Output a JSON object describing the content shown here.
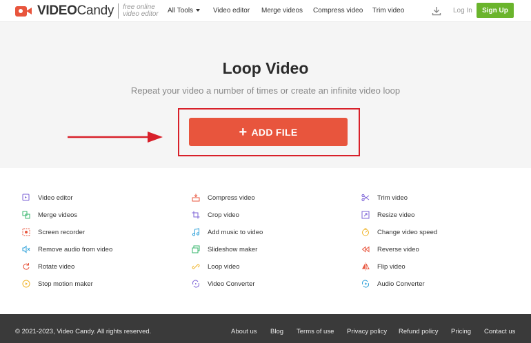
{
  "header": {
    "logo": {
      "brand_bold": "VIDEO",
      "brand_regular": "Candy",
      "tagline_line1": "free online",
      "tagline_line2": "video editor"
    },
    "nav": [
      {
        "label": "All Tools",
        "has_caret": true
      },
      {
        "label": "Video editor"
      },
      {
        "label": "Merge videos"
      },
      {
        "label": "Compress video"
      },
      {
        "label": "Trim video"
      }
    ],
    "download_icon": "download-icon",
    "login_label": "Log In",
    "signup_label": "Sign Up"
  },
  "hero": {
    "title": "Loop Video",
    "subtitle": "Repeat your video a number of times or create an infinite video loop",
    "add_file_label": "ADD FILE"
  },
  "tools": {
    "col1": [
      {
        "label": "Video editor",
        "icon": "video-editor-icon",
        "color": "#7b61d6"
      },
      {
        "label": "Merge videos",
        "icon": "merge-icon",
        "color": "#36b56b"
      },
      {
        "label": "Screen recorder",
        "icon": "screen-recorder-icon",
        "color": "#e8553d"
      },
      {
        "label": "Remove audio from video",
        "icon": "mute-icon",
        "color": "#2a9fd8"
      },
      {
        "label": "Rotate video",
        "icon": "rotate-icon",
        "color": "#e8553d"
      },
      {
        "label": "Stop motion maker",
        "icon": "play-circle-icon",
        "color": "#f0b429"
      }
    ],
    "col2": [
      {
        "label": "Compress video",
        "icon": "compress-icon",
        "color": "#e8553d"
      },
      {
        "label": "Crop video",
        "icon": "crop-icon",
        "color": "#7b61d6"
      },
      {
        "label": "Add music to video",
        "icon": "music-note-icon",
        "color": "#2a9fd8"
      },
      {
        "label": "Slideshow maker",
        "icon": "slideshow-icon",
        "color": "#36b56b"
      },
      {
        "label": "Loop video",
        "icon": "link-icon",
        "color": "#f0b429"
      },
      {
        "label": "Video Converter",
        "icon": "converter-icon",
        "color": "#7b61d6"
      }
    ],
    "col3": [
      {
        "label": "Trim video",
        "icon": "scissors-icon",
        "color": "#7b61d6"
      },
      {
        "label": "Resize video",
        "icon": "resize-icon",
        "color": "#7b61d6"
      },
      {
        "label": "Change video speed",
        "icon": "speed-icon",
        "color": "#f0b429"
      },
      {
        "label": "Reverse video",
        "icon": "reverse-icon",
        "color": "#e8553d"
      },
      {
        "label": "Flip video",
        "icon": "flip-icon",
        "color": "#e8553d"
      },
      {
        "label": "Audio Converter",
        "icon": "audio-converter-icon",
        "color": "#2a9fd8"
      }
    ]
  },
  "footer": {
    "copyright": "© 2021-2023, Video Candy. All rights reserved.",
    "links": [
      "About us",
      "Blog",
      "Terms of use",
      "Privacy policy",
      "Refund policy",
      "Pricing",
      "Contact us"
    ]
  },
  "colors": {
    "accent": "#e8553d",
    "signup_green": "#6ab42c",
    "highlight_red": "#d8202a",
    "footer_bg": "#3a3a3a",
    "hero_bg": "#f5f5f5"
  }
}
